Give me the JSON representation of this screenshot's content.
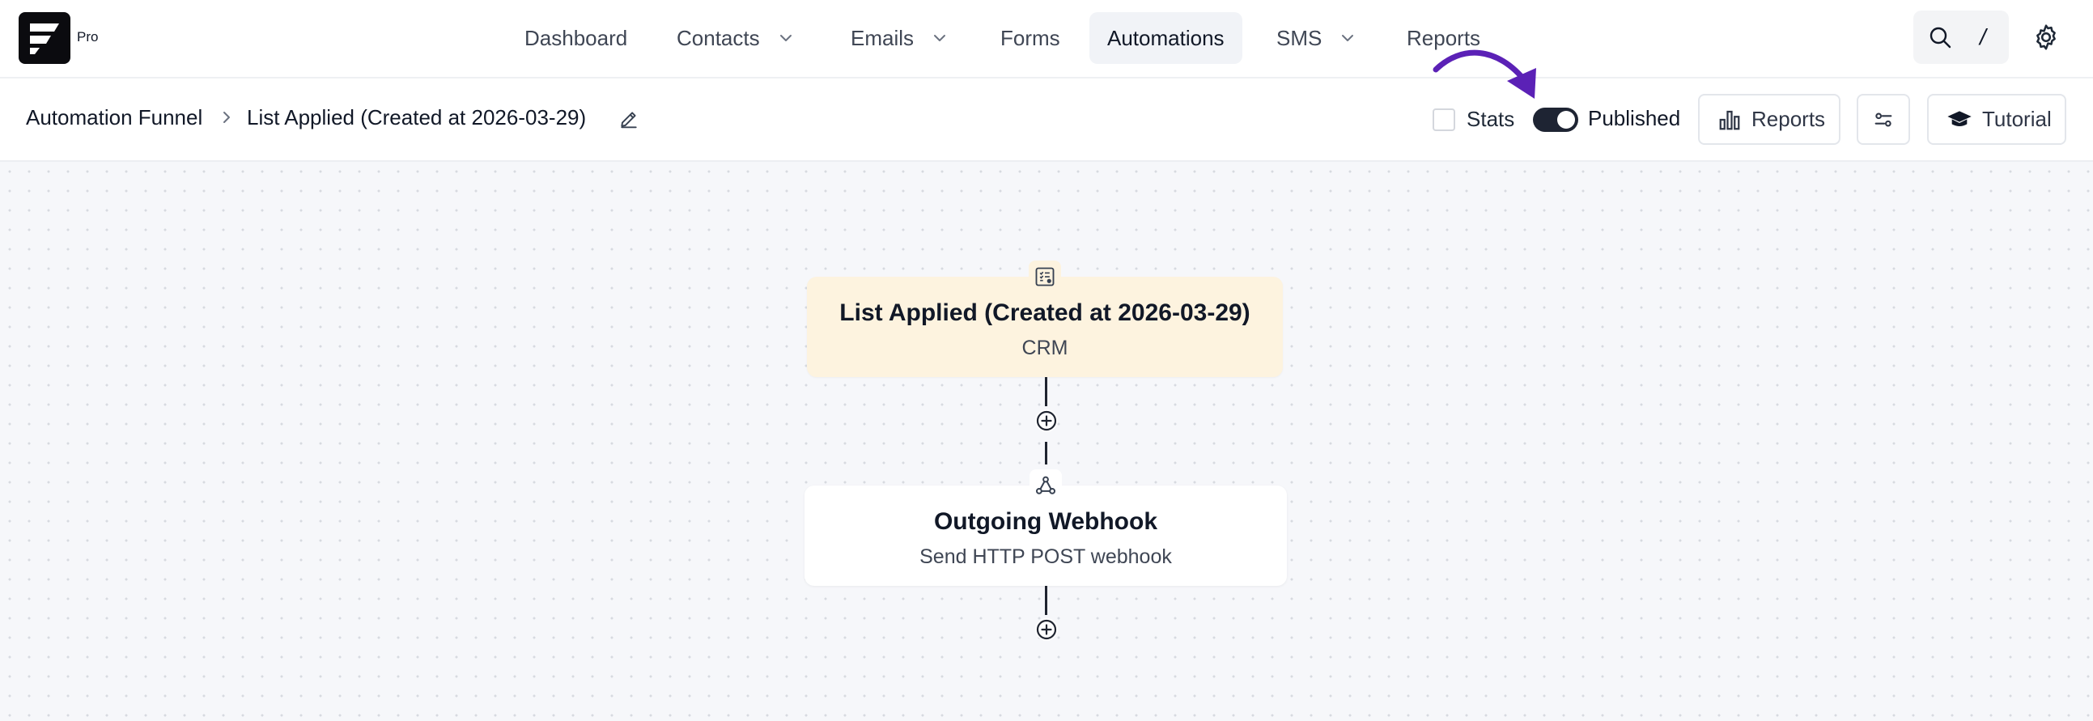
{
  "app": {
    "logo_tag": "Pro"
  },
  "nav": {
    "items": [
      {
        "label": "Dashboard",
        "has_dropdown": false,
        "active": false
      },
      {
        "label": "Contacts",
        "has_dropdown": true,
        "active": false
      },
      {
        "label": "Emails",
        "has_dropdown": true,
        "active": false
      },
      {
        "label": "Forms",
        "has_dropdown": false,
        "active": false
      },
      {
        "label": "Automations",
        "has_dropdown": false,
        "active": true
      },
      {
        "label": "SMS",
        "has_dropdown": true,
        "active": false
      },
      {
        "label": "Reports",
        "has_dropdown": false,
        "active": false
      }
    ],
    "search_shortcut": "/"
  },
  "subheader": {
    "breadcrumb_root": "Automation Funnel",
    "breadcrumb_current": "List Applied (Created at 2026-03-29)",
    "stats_label": "Stats",
    "stats_checked": false,
    "published_label": "Published",
    "published_on": true,
    "reports_button": "Reports",
    "tutorial_button": "Tutorial"
  },
  "funnel": {
    "trigger": {
      "title": "List Applied (Created at 2026-03-29)",
      "subtitle": "CRM",
      "icon": "list-icon"
    },
    "action": {
      "title": "Outgoing Webhook",
      "subtitle": "Send HTTP POST webhook",
      "icon": "webhook-icon"
    }
  },
  "colors": {
    "accent_arrow": "#5b21b6",
    "trigger_bg": "#fdf3df",
    "toggle_on": "#1e2433"
  }
}
